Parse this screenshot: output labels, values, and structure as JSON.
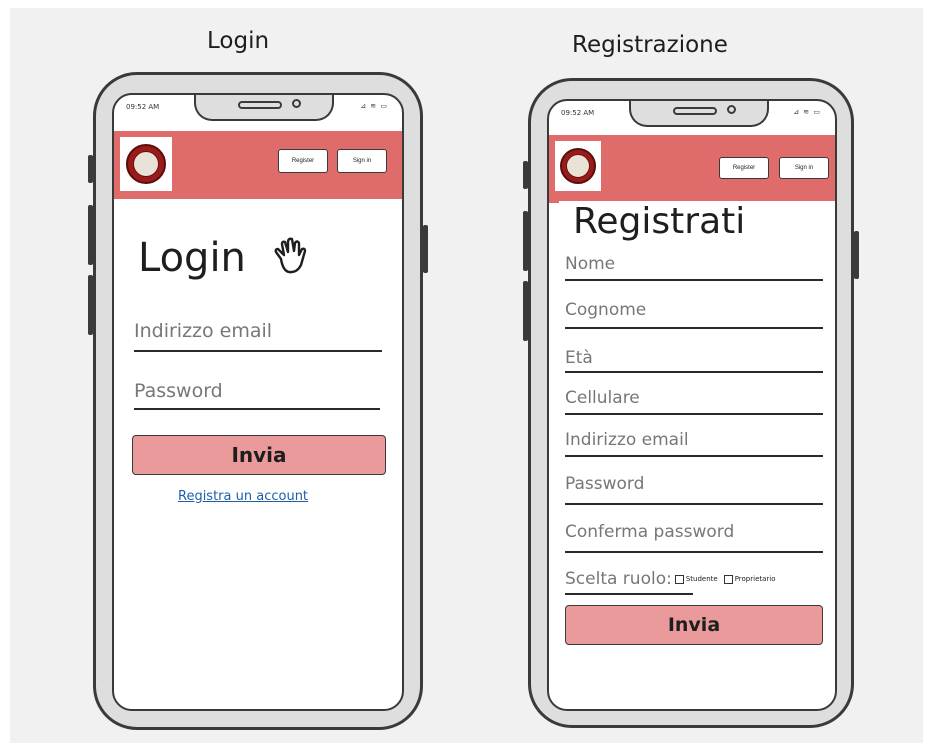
{
  "screens": {
    "login": {
      "title": "Login",
      "status_time": "09:52 AM",
      "status_icons": "⊿ ≋ ▭",
      "header": {
        "register_label": "Register",
        "signin_label": "Sign in"
      },
      "heading": "Login",
      "heading_icon": "waving-hand-icon",
      "fields": {
        "email_placeholder": "Indirizzo email",
        "password_placeholder": "Password"
      },
      "submit_label": "Invia",
      "register_link": "Registra un account"
    },
    "registration": {
      "title": "Registrazione",
      "status_time": "09:52 AM",
      "status_icons": "⊿ ≋ ▭",
      "header": {
        "register_label": "Register",
        "signin_label": "Sign in"
      },
      "heading": "Registrati",
      "fields": [
        "Nome",
        "Cognome",
        "Età",
        "Cellulare",
        "Indirizzo email",
        "Password",
        "Conferma password"
      ],
      "role": {
        "label": "Scelta ruolo:",
        "options": [
          "Studente",
          "Proprietario"
        ]
      },
      "submit_label": "Invia"
    }
  },
  "colors": {
    "header": "#e06b6b",
    "button": "#ea9a9a",
    "link": "#1f5fa8",
    "background": "#f1f1f1"
  }
}
